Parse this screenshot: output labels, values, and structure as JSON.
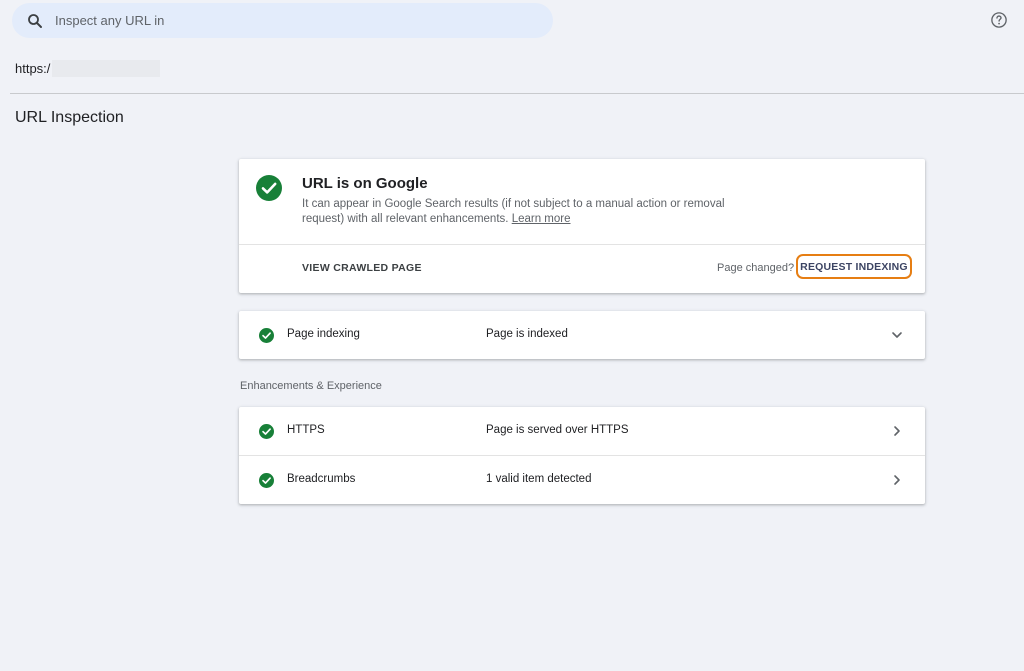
{
  "search": {
    "placeholder": "Inspect any URL in",
    "icon": "search-icon"
  },
  "help": {
    "icon": "help-circle-icon"
  },
  "inspected_url": {
    "text": "https:/"
  },
  "page_title": "URL Inspection",
  "status_card": {
    "title": "URL is on Google",
    "description": "It can appear in Google Search results (if not subject to a manual action or removal request) with all relevant enhancements.",
    "learn_more": "Learn more",
    "view_crawled_label": "VIEW CRAWLED PAGE",
    "page_changed_label": "Page changed?",
    "request_indexing_label": "REQUEST INDEXING"
  },
  "indexing": {
    "label": "Page indexing",
    "value": "Page is indexed"
  },
  "enhancements": {
    "heading": "Enhancements & Experience",
    "items": [
      {
        "label": "HTTPS",
        "value": "Page is served over HTTPS"
      },
      {
        "label": "Breadcrumbs",
        "value": "1 valid item detected"
      }
    ]
  },
  "colors": {
    "success_green": "#188038",
    "highlight_orange": "#e67e13",
    "background": "#f0f2f7",
    "search_background": "#e3ecfb"
  }
}
